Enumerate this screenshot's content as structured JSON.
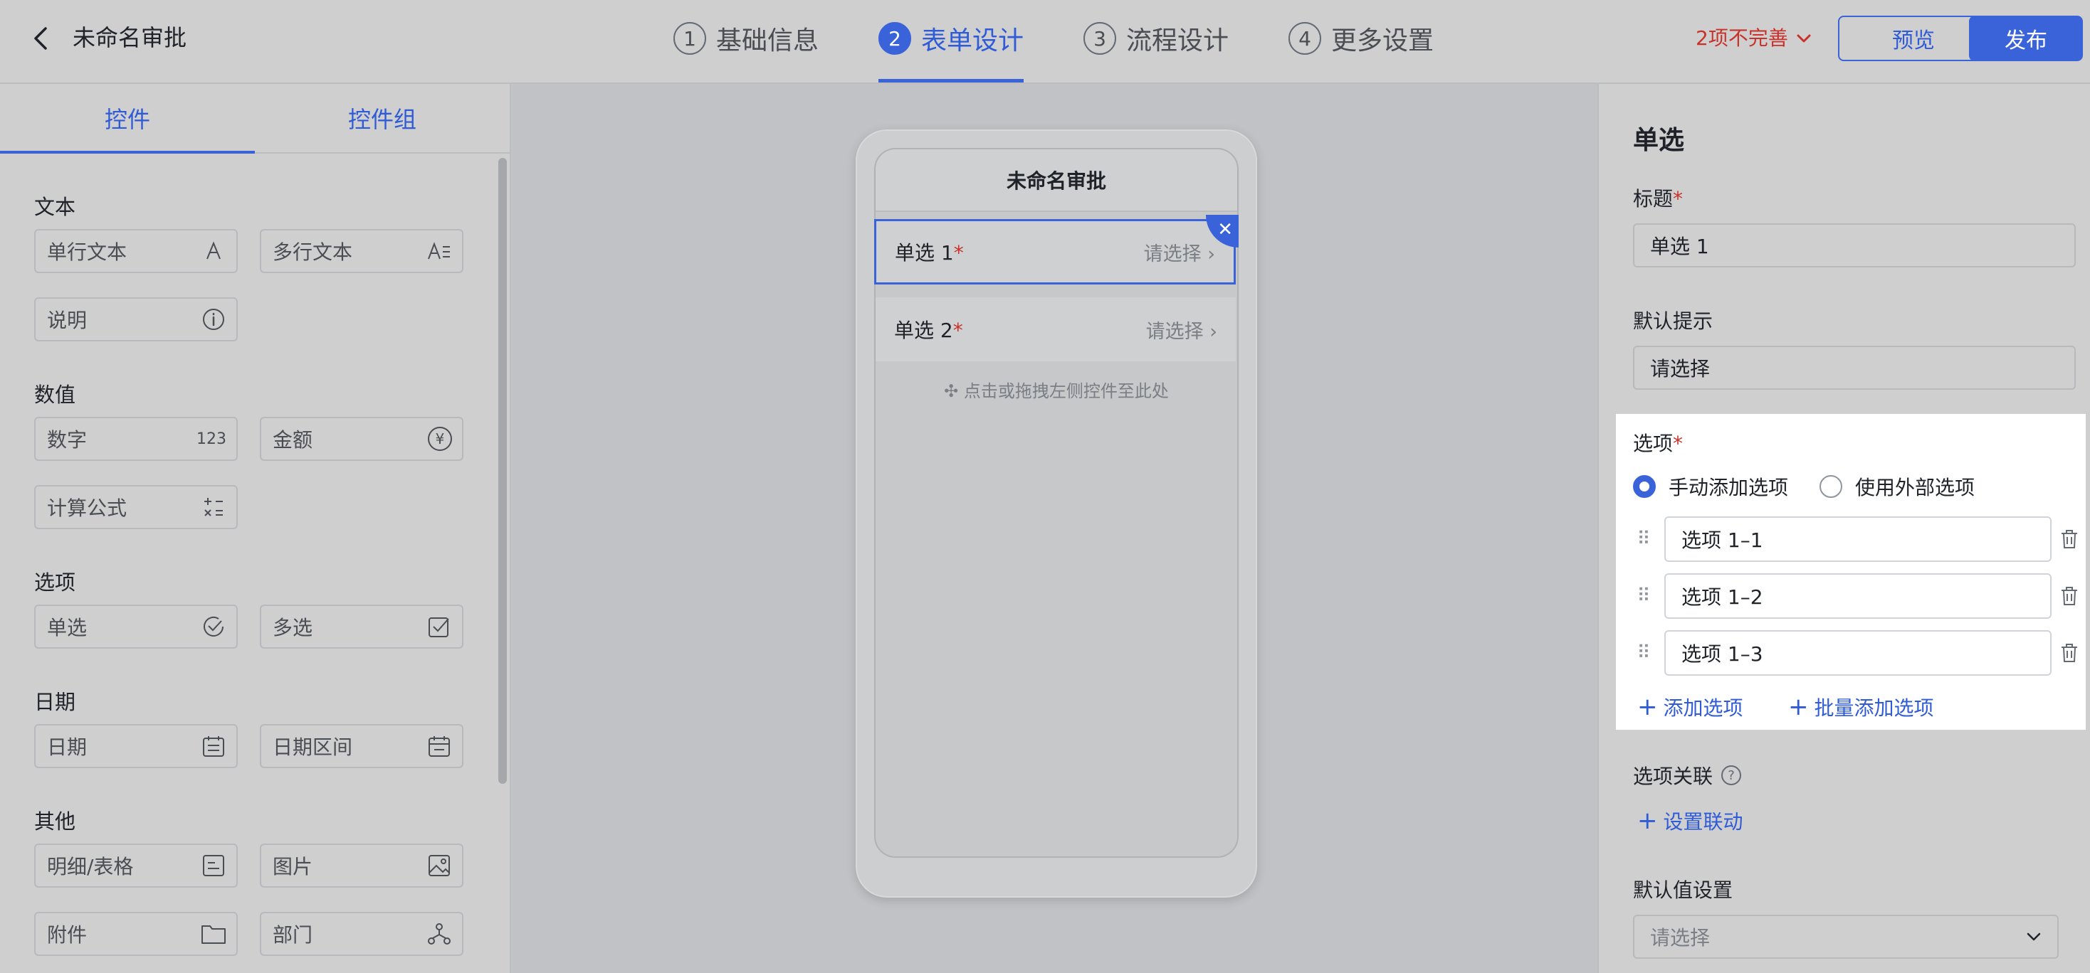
{
  "header": {
    "title": "未命名审批",
    "steps": [
      {
        "num": "1",
        "label": "基础信息"
      },
      {
        "num": "2",
        "label": "表单设计"
      },
      {
        "num": "3",
        "label": "流程设计"
      },
      {
        "num": "4",
        "label": "更多设置"
      }
    ],
    "incomplete": "2项不完善",
    "preview": "预览",
    "publish": "发布"
  },
  "left": {
    "tabs": [
      "控件",
      "控件组"
    ],
    "sections": {
      "text": "文本",
      "number": "数值",
      "option": "选项",
      "date": "日期",
      "other": "其他"
    },
    "controls": {
      "single_line": "单行文本",
      "multi_line": "多行文本",
      "description": "说明",
      "number": "数字",
      "number_icon": "123",
      "amount": "金额",
      "amount_icon": "¥",
      "formula": "计算公式",
      "single_choice": "单选",
      "multi_choice": "多选",
      "date": "日期",
      "date_range": "日期区间",
      "detail_table": "明细/表格",
      "image": "图片",
      "attachment": "附件",
      "department": "部门"
    }
  },
  "phone": {
    "title": "未命名审批",
    "fields": [
      {
        "label": "单选 1",
        "placeholder": "请选择"
      },
      {
        "label": "单选 2",
        "placeholder": "请选择"
      }
    ],
    "hint": "点击或拖拽左侧控件至此处"
  },
  "right": {
    "heading": "单选",
    "title_label": "标题",
    "title_value": "单选 1",
    "default_hint_label": "默认提示",
    "default_hint_value": "请选择",
    "options_label": "选项",
    "radio_manual": "手动添加选项",
    "radio_external": "使用外部选项",
    "options": [
      "选项 1–1",
      "选项 1–2",
      "选项 1–3"
    ],
    "add_option": "添加选项",
    "batch_add": "批量添加选项",
    "association_label": "选项关联",
    "set_linkage": "设置联动",
    "default_value_label": "默认值设置",
    "default_value_placeholder": "请选择"
  },
  "colors": {
    "accent": "#3a63d9",
    "error": "#c8322a"
  }
}
